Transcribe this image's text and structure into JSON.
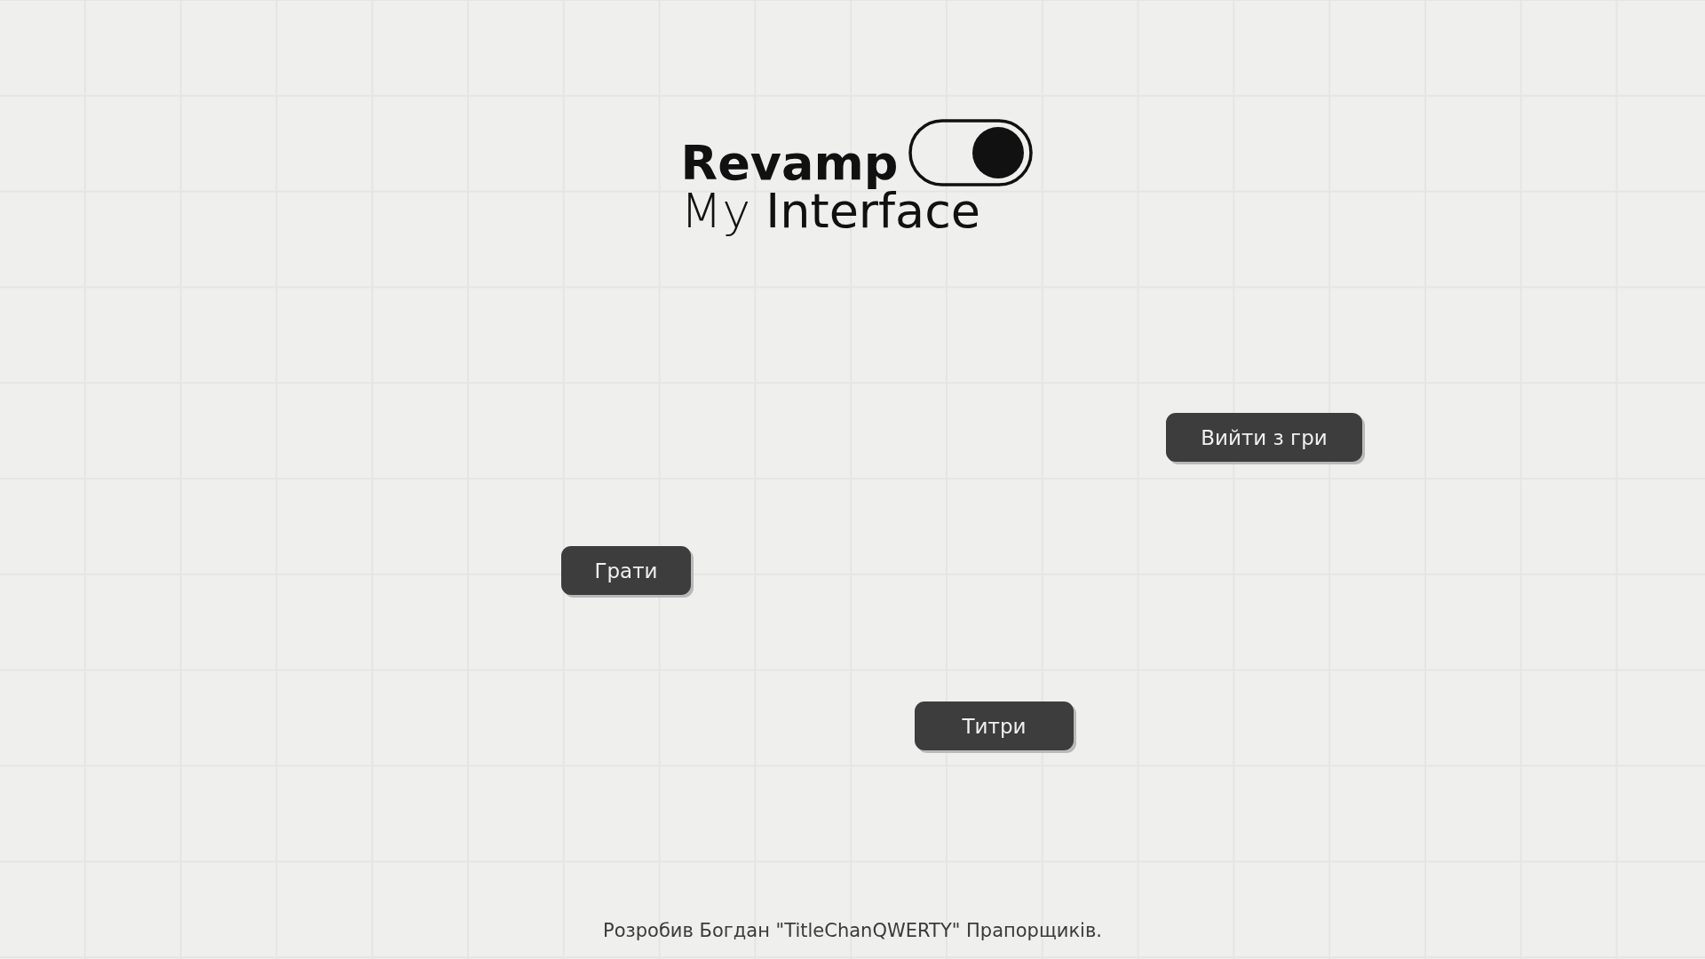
{
  "logo": {
    "line_1": "Revamp",
    "line_2": "My **Interface**"
  },
  "menu_buttons": [
    {
      "label": "Вийти з гри"
    },
    {
      "label": "Грати"
    },
    {
      "label": "Титри"
    }
  ],
  "credits": "Розробив Богдан \"TitleChanQWERTY\" Прапорщиків."
}
